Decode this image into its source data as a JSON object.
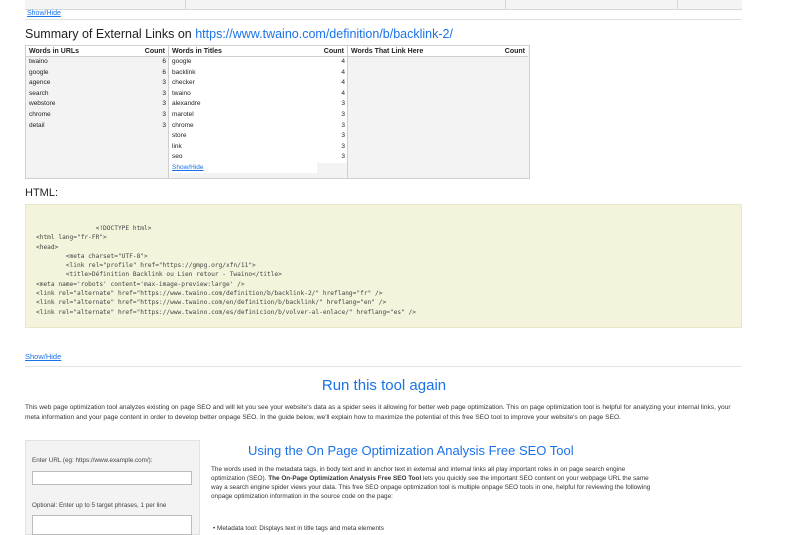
{
  "top": {
    "showhide": "Show/Hide"
  },
  "summary": {
    "prefix": "Summary of External Links on ",
    "url": "https://www.twaino.com/definition/b/backlink-2/"
  },
  "links_table": {
    "urls_header": "Words in URLs",
    "urls_count_header": "Count",
    "titles_header": "Words in Titles",
    "titles_count_header": "Count",
    "here_header": "Words That Link Here",
    "here_count_header": "Count",
    "urls": [
      {
        "word": "twaino",
        "count": "6"
      },
      {
        "word": "google",
        "count": "6"
      },
      {
        "word": "agence",
        "count": "3"
      },
      {
        "word": "search",
        "count": "3"
      },
      {
        "word": "webstore",
        "count": "3"
      },
      {
        "word": "chrome",
        "count": "3"
      },
      {
        "word": "detail",
        "count": "3"
      }
    ],
    "titles": [
      {
        "word": "google",
        "count": "4"
      },
      {
        "word": "backlink",
        "count": "4"
      },
      {
        "word": "checker",
        "count": "4"
      },
      {
        "word": "twaino",
        "count": "4"
      },
      {
        "word": "alexandre",
        "count": "3"
      },
      {
        "word": "marotel",
        "count": "3"
      },
      {
        "word": "chrome",
        "count": "3"
      },
      {
        "word": "store",
        "count": "3"
      },
      {
        "word": "link",
        "count": "3"
      },
      {
        "word": "seo",
        "count": "3"
      }
    ],
    "titles_showhide": "Show/Hide"
  },
  "html_section": {
    "label": "HTML:",
    "code": "                <!DOCTYPE html>\n<html lang=\"fr-FR\">\n<head>\n        <meta charset=\"UTF-8\">\n        <link rel=\"profile\" href=\"https://gmpg.org/xfn/11\">\n        <title>Définition Backlink ou Lien retour - Twaino</title>\n<meta name='robots' content='max-image-preview:large' />\n<link rel=\"alternate\" href=\"https://www.twaino.com/definition/b/backlink-2/\" hreflang=\"fr\" />\n<link rel=\"alternate\" href=\"https://www.twaino.com/en/definition/b/backlink/\" hreflang=\"en\" />\n<link rel=\"alternate\" href=\"https://www.twaino.com/es/definicion/b/volver-al-enlace/\" hreflang=\"es\" />",
    "showhide": "Show/Hide"
  },
  "run_again": "Run this tool again",
  "description": "This web page optimization tool analyzes existing on page SEO and will let you see your website's data as a spider sees it allowing for better web page optimization. This on page optimization tool is helpful for analyzing your internal links, your meta information and your page content in order to develop better onpage SEO. In the guide below, we'll explain how to maximize the potential of this free SEO tool to improve your website's on page SEO.",
  "form": {
    "url_label": "Enter URL (eg: https://www.example.com/):",
    "url_value": "",
    "phrases_label": "Optional: Enter up to 5 target phrases, 1 per line",
    "phrases_value": ""
  },
  "section": {
    "title": "Using the On Page Optimization Analysis Free SEO Tool",
    "body_part1": "The words used in the metadata tags, in body text and in anchor text in external and internal links all play important roles in on page search engine optimization (SEO). ",
    "body_bold": "The On-Page Optimization Analysis Free SEO Tool",
    "body_part2": " lets you quickly see the important SEO content on your webpage URL the same way a search engine spider views your data. This free SEO onpage optimization tool is multiple onpage SEO tools in one, helpful for reviewing the following onpage optimization information in the source code on the page:",
    "bullet": "•  Metadata tool: Displays text in title tags and meta elements"
  }
}
